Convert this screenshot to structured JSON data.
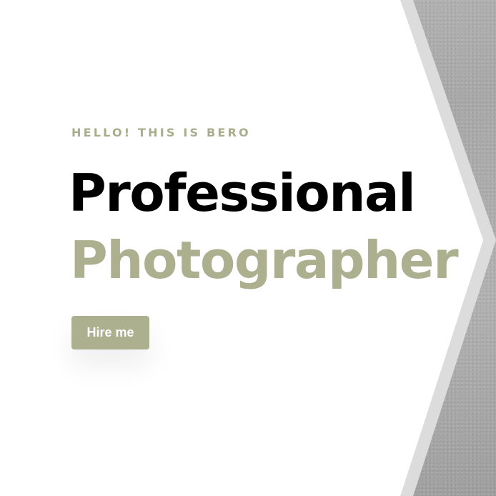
{
  "hero": {
    "eyebrow": "HELLO! THIS IS BERO",
    "title_line1": "Professional",
    "title_line2": "Photographer",
    "cta_label": "Hire me"
  },
  "colors": {
    "accent": "#adb08f",
    "title": "#000000",
    "background": "#ffffff",
    "photo_gray": "#b0b0b0"
  }
}
